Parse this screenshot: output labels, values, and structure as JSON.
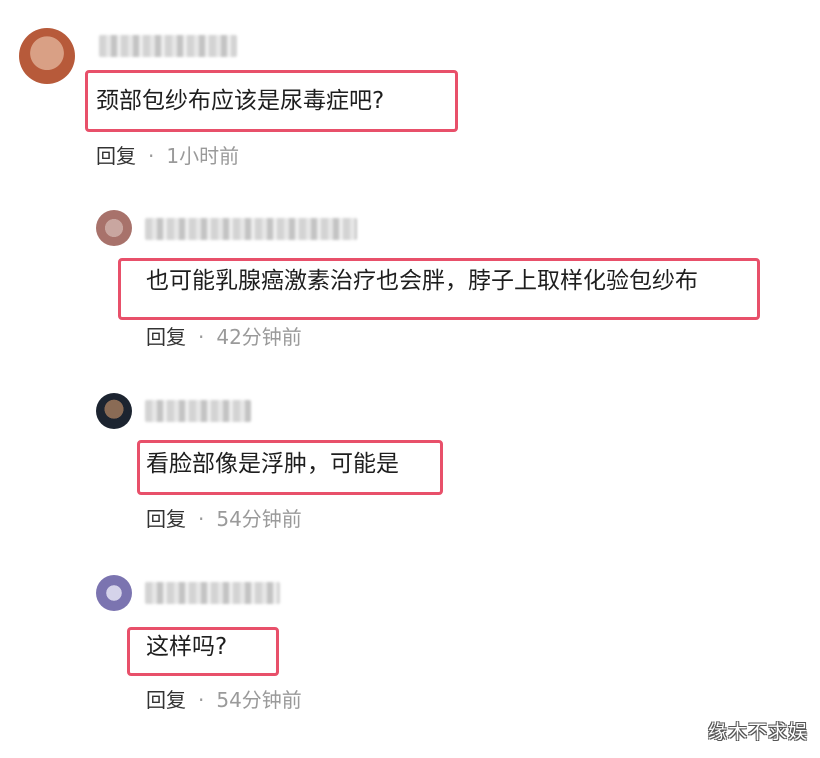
{
  "comments": [
    {
      "text": "颈部包纱布应该是尿毒症吧?",
      "reply_label": "回复",
      "separator": "·",
      "time": "1小时前"
    },
    {
      "text": "也可能乳腺癌激素治疗也会胖，脖子上取样化验包纱布",
      "reply_label": "回复",
      "separator": "·",
      "time": "42分钟前"
    },
    {
      "text": "看脸部像是浮肿，可能是",
      "reply_label": "回复",
      "separator": "·",
      "time": "54分钟前"
    },
    {
      "text": "这样吗?",
      "reply_label": "回复",
      "separator": "·",
      "time": "54分钟前"
    }
  ],
  "watermark": "缘木不求娱",
  "colors": {
    "highlight": "#e8506a",
    "meta": "#9a9a9a"
  }
}
